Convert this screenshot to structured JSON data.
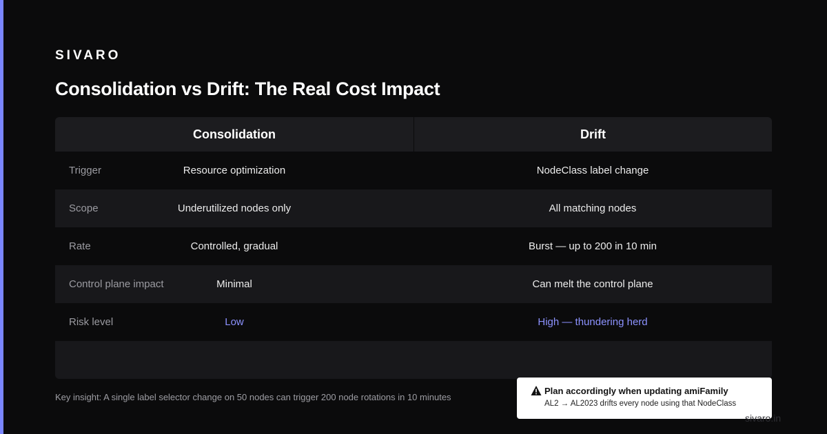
{
  "brand": "SIVARO",
  "title": "Consolidation vs Drift: The Real Cost Impact",
  "table": {
    "headers": [
      "Consolidation",
      "Drift"
    ],
    "rows": [
      {
        "label": "Trigger",
        "consolidation": "Resource optimization",
        "drift": "NodeClass label change"
      },
      {
        "label": "Scope",
        "consolidation": "Underutilized nodes only",
        "drift": "All matching nodes"
      },
      {
        "label": "Rate",
        "consolidation": "Controlled, gradual",
        "drift": "Burst — up to 200 in 10 min"
      },
      {
        "label": "Control plane impact",
        "consolidation": "Minimal",
        "drift": "Can melt the control plane"
      },
      {
        "label": "Risk level",
        "consolidation": "Low",
        "drift": "High — thundering herd"
      }
    ]
  },
  "insight": "Key insight: A single label selector change on 50 nodes can trigger 200 node rotations in 10 minutes",
  "callout": {
    "icon": "warning-icon",
    "title": "Plan accordingly when updating amiFamily",
    "body": "AL2 → AL2023 drifts every node using that NodeClass"
  },
  "footer": "sivaro.in",
  "colors": {
    "background": "#0b0b0c",
    "accent": "#7a86ff",
    "risk_text": "#8c92ff",
    "header_bg": "#1c1c1f",
    "row_shade": "#18181b"
  }
}
